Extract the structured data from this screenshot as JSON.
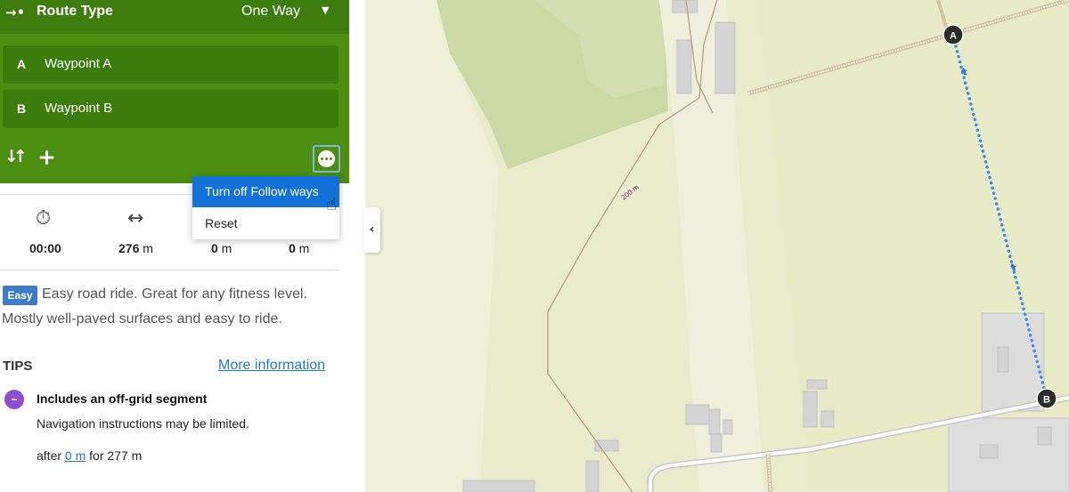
{
  "route_type": {
    "icon": "route-direction-icon",
    "label": "Route Type",
    "value": "One Way",
    "caret": "▼"
  },
  "waypoints": [
    {
      "letter": "A",
      "name": "Waypoint A"
    },
    {
      "letter": "B",
      "name": "Waypoint B"
    }
  ],
  "actions": {
    "swap_icon": "swap-icon",
    "add_icon": "add-icon",
    "more_icon": "more-options-icon"
  },
  "menu": {
    "items": [
      {
        "label": "Turn off Follow ways",
        "active": true
      },
      {
        "label": "Reset",
        "active": false
      }
    ]
  },
  "stats": [
    {
      "icon": "stopwatch-icon",
      "value": "00:00",
      "unit": ""
    },
    {
      "icon": "distance-icon",
      "value": "276",
      "unit": " m"
    },
    {
      "icon": "ascent-icon",
      "value": "0",
      "unit": " m"
    },
    {
      "icon": "descent-icon",
      "value": "0",
      "unit": " m"
    }
  ],
  "difficulty": {
    "badge": "Easy",
    "line1": "Easy road ride. Great for any fitness level.",
    "line2": "Mostly well-paved surfaces and easy to ride."
  },
  "tips": {
    "title": "TIPS",
    "more_info": "More information",
    "item": {
      "icon": "off-grid-icon",
      "title": "Includes an off-grid segment",
      "description": "Navigation instructions may be limited.",
      "after_prefix": "after ",
      "after_link": "0 m",
      "after_suffix": " for 277 m"
    }
  },
  "map": {
    "marker_a": "A",
    "marker_b": "B",
    "scale_label": "200 m",
    "colors": {
      "route": "#3b8ee8",
      "marker": "#2b2b2b",
      "meadow": "#e9eccb",
      "forest": "#cdd9a5",
      "road": "#ffffff"
    }
  },
  "colors": {
    "header": "#3d7d0e",
    "panel": "#4c8e0f",
    "waypoint": "#3b7c0c",
    "menu_active": "#1272d8",
    "link": "#1f7bd8",
    "badge": "#3f7cc7",
    "tip_icon": "#8b4fd0"
  }
}
